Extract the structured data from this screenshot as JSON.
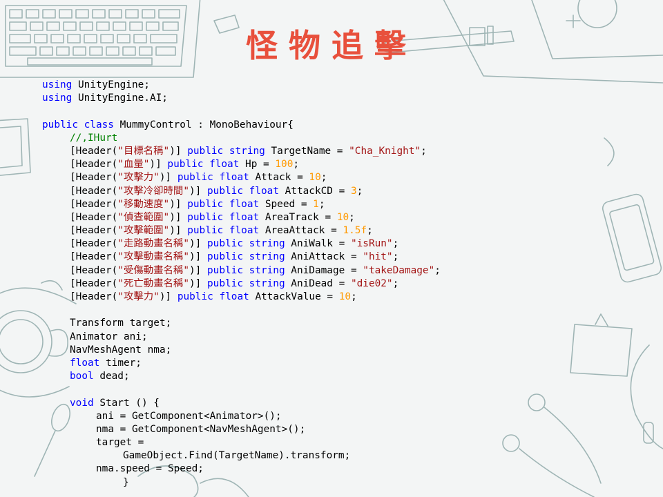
{
  "title": "怪物追擊",
  "code": {
    "l1": {
      "k": "using",
      "t": " UnityEngine;"
    },
    "l2": {
      "k": "using",
      "t": " UnityEngine.AI;"
    },
    "l4": {
      "k1": "public",
      "k2": " class",
      "t": " MummyControl : MonoBehaviour{"
    },
    "l5": {
      "c": "//,IHurt"
    },
    "fields": [
      {
        "pre": "[Header(",
        "label": "\"目標名稱\"",
        "post": ")] ",
        "k1": "public",
        "k2": " string",
        "name": " TargetName = ",
        "val": "\"Cha_Knight\"",
        "vt": "str",
        "end": ";"
      },
      {
        "pre": "[Header(",
        "label": "\"血量\"",
        "post": ")] ",
        "k1": "public",
        "k2": " float",
        "name": " Hp = ",
        "val": "100",
        "vt": "num",
        "end": ";"
      },
      {
        "pre": "[Header(",
        "label": "\"攻擊力\"",
        "post": ")] ",
        "k1": "public",
        "k2": " float",
        "name": " Attack = ",
        "val": "10",
        "vt": "num",
        "end": ";"
      },
      {
        "pre": "[Header(",
        "label": "\"攻擊冷卻時間\"",
        "post": ")] ",
        "k1": "public",
        "k2": " float",
        "name": " AttackCD = ",
        "val": "3",
        "vt": "num",
        "end": ";"
      },
      {
        "pre": "[Header(",
        "label": "\"移動速度\"",
        "post": ")] ",
        "k1": "public",
        "k2": " float",
        "name": " Speed = ",
        "val": "1",
        "vt": "num",
        "end": ";"
      },
      {
        "pre": "[Header(",
        "label": "\"偵查範圍\"",
        "post": ")] ",
        "k1": "public",
        "k2": " float",
        "name": " AreaTrack = ",
        "val": "10",
        "vt": "num",
        "end": ";"
      },
      {
        "pre": "[Header(",
        "label": "\"攻擊範圍\"",
        "post": ")] ",
        "k1": "public",
        "k2": " float",
        "name": " AreaAttack = ",
        "val": "1.5f",
        "vt": "num",
        "end": ";"
      },
      {
        "pre": "[Header(",
        "label": "\"走路動畫名稱\"",
        "post": ")] ",
        "k1": "public",
        "k2": " string",
        "name": " AniWalk = ",
        "val": "\"isRun\"",
        "vt": "str",
        "end": ";"
      },
      {
        "pre": "[Header(",
        "label": "\"攻擊動畫名稱\"",
        "post": ")] ",
        "k1": "public",
        "k2": " string",
        "name": " AniAttack = ",
        "val": "\"hit\"",
        "vt": "str",
        "end": ";"
      },
      {
        "pre": "[Header(",
        "label": "\"受傷動畫名稱\"",
        "post": ")] ",
        "k1": "public",
        "k2": " string",
        "name": " AniDamage = ",
        "val": "\"takeDamage\"",
        "vt": "str",
        "end": ";"
      },
      {
        "pre": "[Header(",
        "label": "\"死亡動畫名稱\"",
        "post": ")] ",
        "k1": "public",
        "k2": " string",
        "name": " AniDead = ",
        "val": "\"die02\"",
        "vt": "str",
        "end": ";"
      },
      {
        "pre": "[Header(",
        "label": "\"攻擊力\"",
        "post": ")] ",
        "k1": "public",
        "k2": " float",
        "name": " AttackValue = ",
        "val": "10",
        "vt": "num",
        "end": ";"
      }
    ],
    "l19": {
      "t": "Transform target;"
    },
    "l20": {
      "t": "Animator ani;"
    },
    "l21": {
      "t": "NavMeshAgent nma;"
    },
    "l22": {
      "k": "float",
      "t": " timer;"
    },
    "l23": {
      "k": "bool",
      "t": " dead;"
    },
    "l25": {
      "k": "void",
      "t": " Start () {"
    },
    "l26": {
      "t": "ani = GetComponent<Animator>();"
    },
    "l27": {
      "t": "nma = GetComponent<NavMeshAgent>();"
    },
    "l28": {
      "t": "target ="
    },
    "l29": {
      "t": "GameObject.Find(TargetName).transform;"
    },
    "l30": {
      "t": "nma.speed = Speed;"
    },
    "l31": {
      "t": "}"
    }
  }
}
